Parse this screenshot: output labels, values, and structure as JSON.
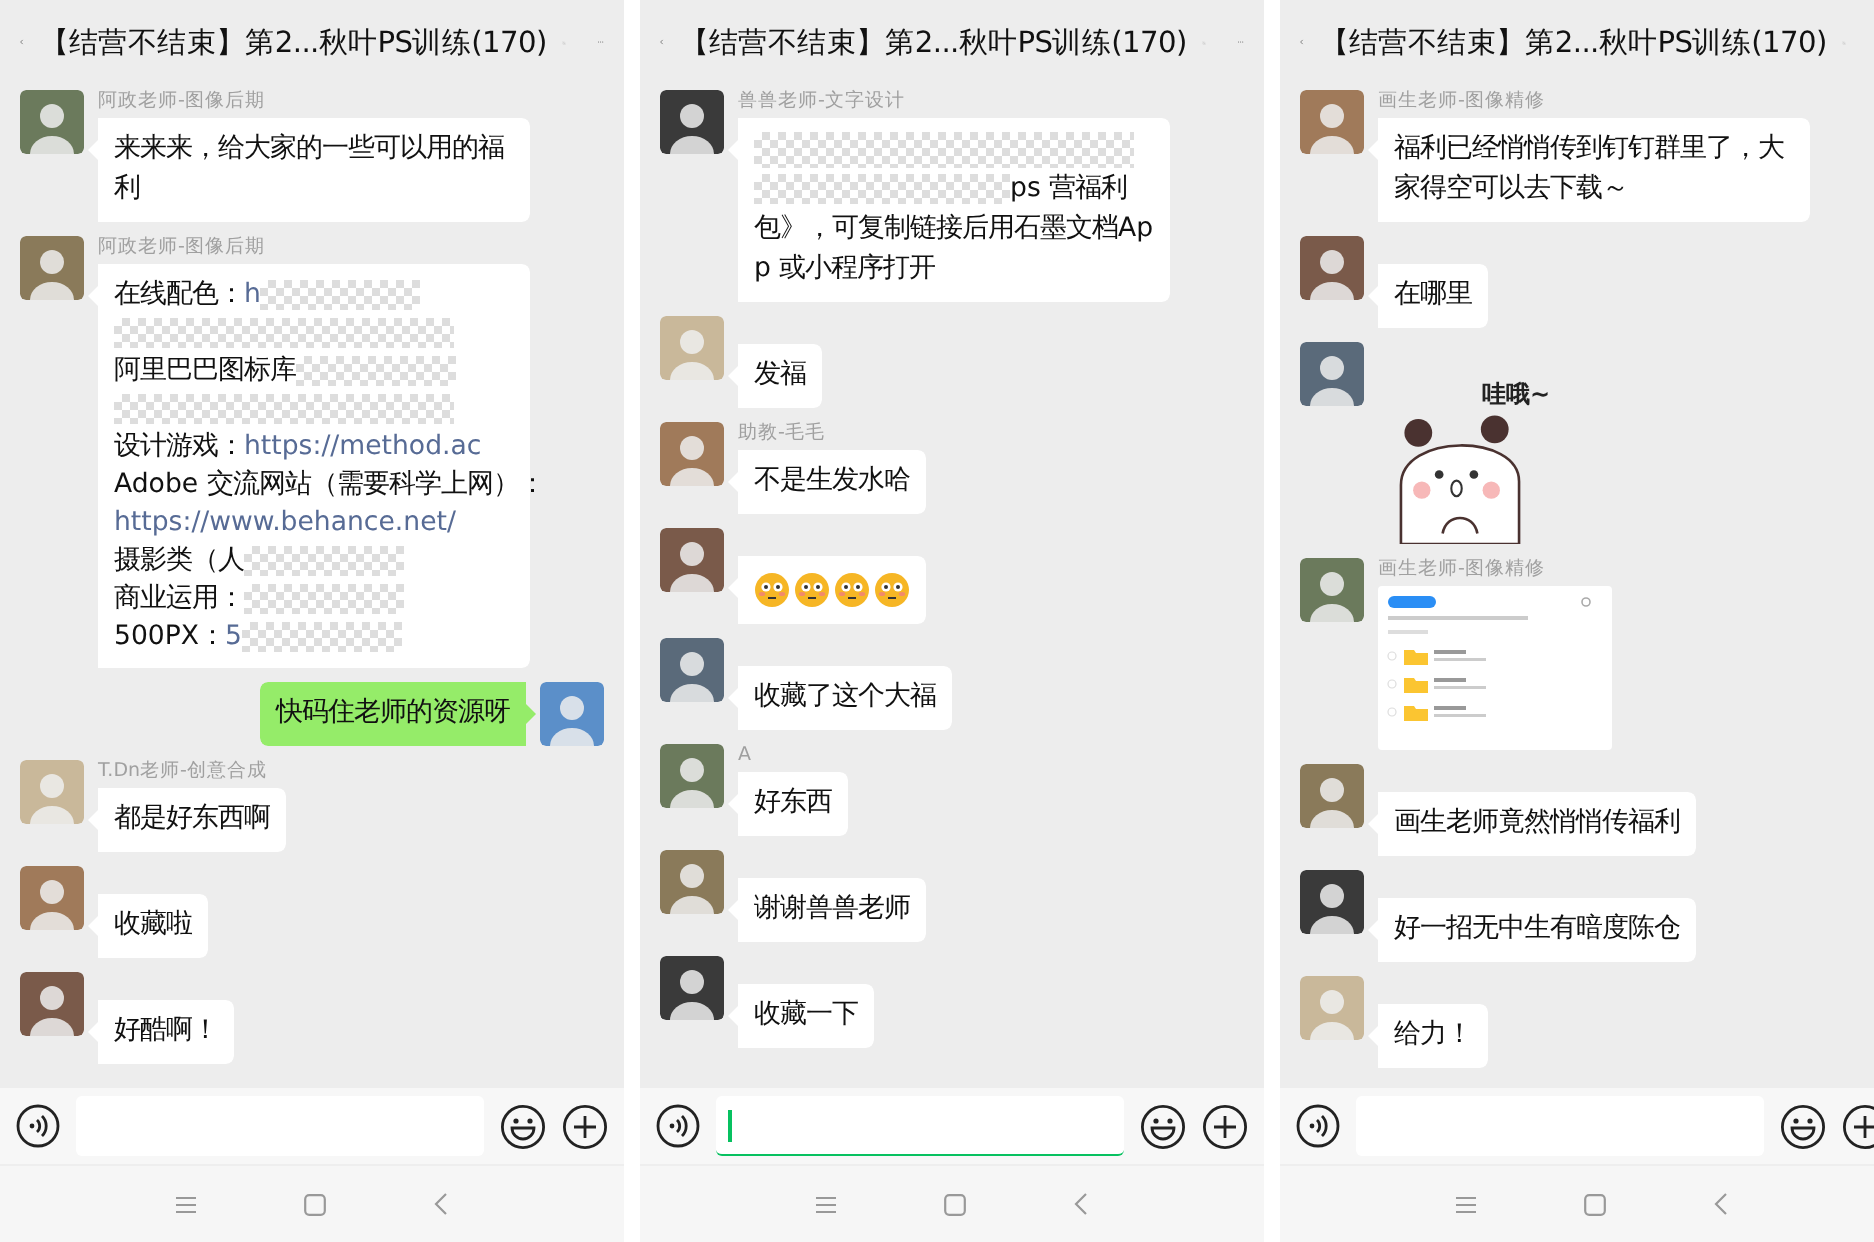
{
  "panels": [
    {
      "header": {
        "title": "【结营不结束】第2...秋叶PS训练(170)"
      },
      "messages": [
        {
          "kind": "text",
          "sender": "阿政老师-图像后期",
          "outgoing": false,
          "text": "来来来，给大家的一些可以用的福利"
        },
        {
          "kind": "lines",
          "sender": "阿政老师-图像后期",
          "outgoing": false,
          "lines": [
            {
              "text": "在线配色：",
              "link": "h",
              "redacted": true
            },
            {
              "redacted": true
            },
            {
              "text": "阿里巴巴图标库",
              "redacted": true
            },
            {
              "redacted": true
            },
            {
              "text": "设计游戏：",
              "link": "https://method.ac",
              "redacted": false
            },
            {
              "text": "Adobe 交流网站（需要科学上网）：",
              "redacted": false
            },
            {
              "link": "https://www.behance.net/",
              "redacted": false
            },
            {
              "text": "摄影类（人",
              "redacted": true
            },
            {
              "text": "商业运用：",
              "redacted": true
            },
            {
              "text": "500PX：",
              "link": "5",
              "redacted": true
            }
          ]
        },
        {
          "kind": "text",
          "outgoing": true,
          "text": "快码住老师的资源呀"
        },
        {
          "kind": "text",
          "sender": "T.Dn老师-创意合成",
          "outgoing": false,
          "text": "都是好东西啊"
        },
        {
          "kind": "text",
          "outgoing": false,
          "text": "收藏啦"
        },
        {
          "kind": "text",
          "outgoing": false,
          "text": "好酷啊！"
        }
      ],
      "input": {
        "focused": false
      }
    },
    {
      "header": {
        "title": "【结营不结束】第2...秋叶PS训练(170)"
      },
      "messages": [
        {
          "kind": "redacted-text",
          "sender": "兽兽老师-文字设计",
          "outgoing": false,
          "text": "ps 营福利包》，可复制链接后用石墨文档App 或小程序打开"
        },
        {
          "kind": "text",
          "outgoing": false,
          "text": "发福"
        },
        {
          "kind": "text",
          "sender": "助教-毛毛",
          "outgoing": false,
          "text": "不是生发水哈"
        },
        {
          "kind": "emoji",
          "outgoing": false,
          "emojis": [
            {
              "kind": "flushed"
            },
            {
              "kind": "flushed"
            },
            {
              "kind": "flushed"
            },
            {
              "kind": "flushed"
            }
          ]
        },
        {
          "kind": "text",
          "outgoing": false,
          "text": "收藏了这个大福"
        },
        {
          "kind": "text",
          "sender": "A",
          "outgoing": false,
          "text": "好东西"
        },
        {
          "kind": "text",
          "outgoing": false,
          "text": "谢谢兽兽老师"
        },
        {
          "kind": "text",
          "outgoing": false,
          "text": "收藏一下"
        }
      ],
      "input": {
        "focused": true
      }
    },
    {
      "header": {
        "title": "【结营不结束】第2...秋叶PS训练(170)"
      },
      "messages": [
        {
          "kind": "text",
          "sender": "画生老师-图像精修",
          "outgoing": false,
          "text": "福利已经悄悄传到钉钉群里了，大家得空可以去下载～"
        },
        {
          "kind": "text",
          "outgoing": false,
          "text": "在哪里"
        },
        {
          "kind": "sticker",
          "outgoing": false,
          "caption": "哇哦~"
        },
        {
          "kind": "screenshot",
          "sender": "画生老师-图像精修",
          "outgoing": false
        },
        {
          "kind": "text",
          "outgoing": false,
          "text": "画生老师竟然悄悄传福利"
        },
        {
          "kind": "text",
          "outgoing": false,
          "text": "好一招无中生有暗度陈仓"
        },
        {
          "kind": "text",
          "outgoing": false,
          "text": "给力！"
        }
      ],
      "input": {
        "focused": false
      }
    }
  ]
}
